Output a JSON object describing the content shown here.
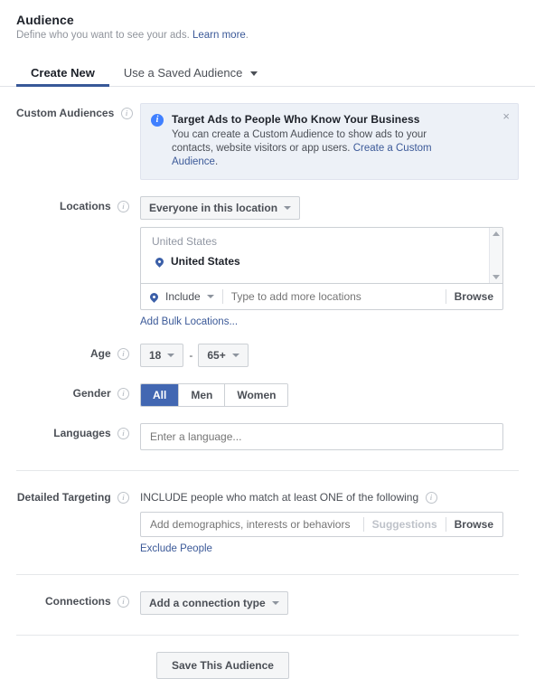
{
  "header": {
    "title": "Audience",
    "subtitle_prefix": "Define who you want to see your ads.",
    "learn_more": "Learn more",
    "subtitle_suffix": "."
  },
  "tabs": [
    {
      "label": "Create New",
      "active": true
    },
    {
      "label": "Use a Saved Audience",
      "active": false
    }
  ],
  "custom_audiences": {
    "label": "Custom Audiences",
    "banner": {
      "icon": "info-circle-icon",
      "title": "Target Ads to People Who Know Your Business",
      "text": "You can create a Custom Audience to show ads to your contacts, website visitors or app users.",
      "link": "Create a Custom Audience",
      "text_suffix": ".",
      "close": "×"
    }
  },
  "locations": {
    "label": "Locations",
    "scope_dropdown": "Everyone in this location",
    "group_header": "United States",
    "selected": [
      {
        "name": "United States",
        "icon": "map-pin-icon"
      }
    ],
    "include_label": "Include",
    "input_placeholder": "Type to add more locations",
    "browse_label": "Browse",
    "bulk_link": "Add Bulk Locations..."
  },
  "age": {
    "label": "Age",
    "min": "18",
    "max": "65+",
    "separator": "-"
  },
  "gender": {
    "label": "Gender",
    "options": [
      {
        "label": "All",
        "selected": true
      },
      {
        "label": "Men",
        "selected": false
      },
      {
        "label": "Women",
        "selected": false
      }
    ]
  },
  "languages": {
    "label": "Languages",
    "placeholder": "Enter a language...",
    "value": ""
  },
  "detailed_targeting": {
    "label": "Detailed Targeting",
    "include_heading": "INCLUDE people who match at least ONE of the following",
    "input_placeholder": "Add demographics, interests or behaviors",
    "suggestions_label": "Suggestions",
    "browse_label": "Browse",
    "exclude_link": "Exclude People"
  },
  "connections": {
    "label": "Connections",
    "dropdown": "Add a connection type"
  },
  "footer": {
    "save_label": "Save This Audience"
  },
  "colors": {
    "brand_blue": "#4267b2",
    "tab_underline": "#385898",
    "link_blue": "#3b5998",
    "banner_bg": "#edf1f7",
    "banner_icon": "#4080ff",
    "border": "#ccd0d5",
    "button_bg": "#f5f6f7"
  }
}
